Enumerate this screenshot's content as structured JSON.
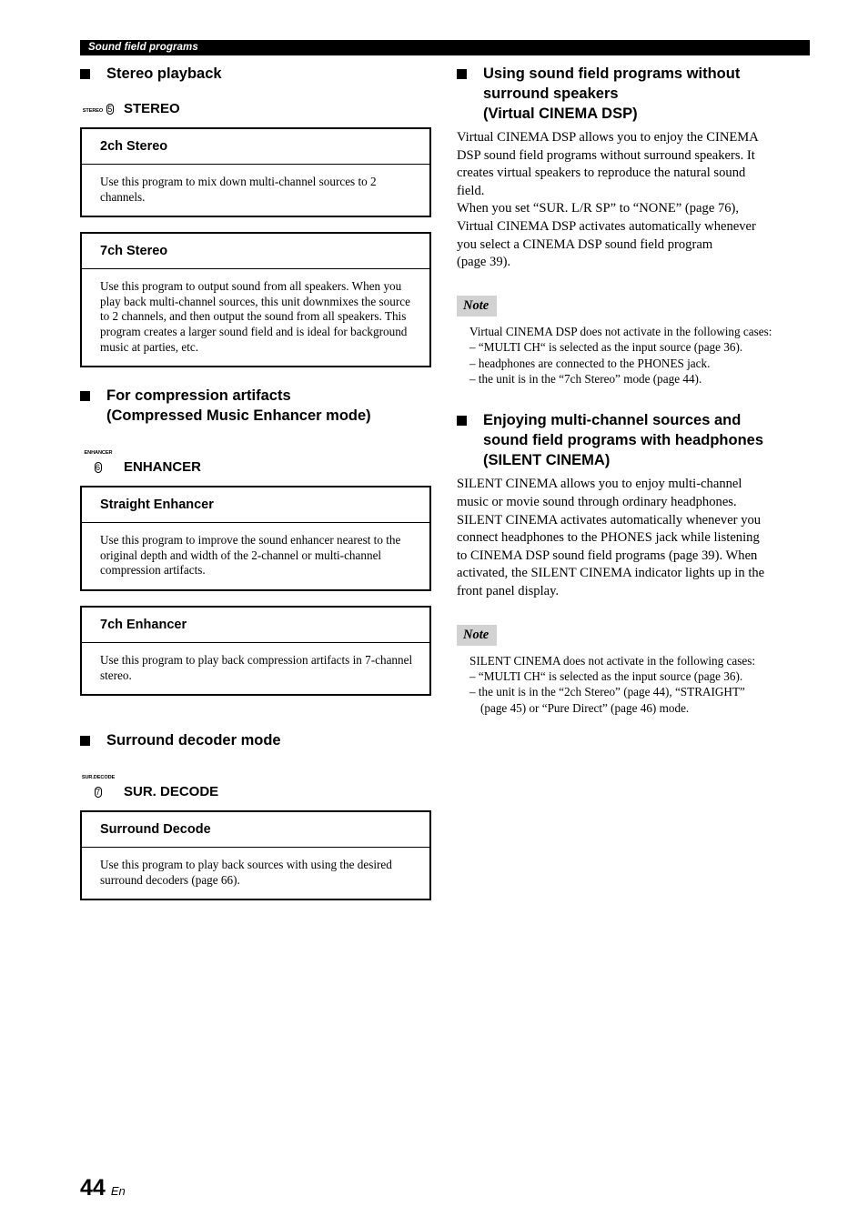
{
  "header": {
    "running_title": "Sound field programs"
  },
  "footer": {
    "page_number": "44",
    "language_code": "En"
  },
  "left_column": {
    "section_stereo": {
      "heading": "Stereo playback",
      "key": {
        "cap_label": "STEREO",
        "number": "5",
        "label": "STEREO"
      },
      "programs": [
        {
          "name": "2ch Stereo",
          "description": "Use this program to mix down multi-channel sources to 2 channels."
        },
        {
          "name": "7ch Stereo",
          "description": "Use this program to output sound from all speakers. When you play back multi-channel sources, this unit downmixes the source to 2 channels, and then output the sound from all speakers. This program creates a larger sound field and is ideal for background music at parties, etc."
        }
      ]
    },
    "section_enhancer": {
      "heading_line1": "For compression artifacts",
      "heading_line2": "(Compressed Music Enhancer mode)",
      "key": {
        "cap_label": "ENHANCER",
        "number": "6",
        "label": "ENHANCER"
      },
      "programs": [
        {
          "name": "Straight Enhancer",
          "description": "Use this program to improve the sound enhancer nearest to the original depth and width of the 2-channel or multi-channel compression artifacts."
        },
        {
          "name": "7ch Enhancer",
          "description": "Use this program to play back compression artifacts in 7-channel stereo."
        }
      ]
    },
    "section_surround_decoder": {
      "heading": "Surround decoder mode",
      "key": {
        "cap_label": "SUR.DECODE",
        "number": "7",
        "label": "SUR. DECODE"
      },
      "programs": [
        {
          "name": "Surround Decode",
          "description": "Use this program to play back sources with using the desired surround decoders (page 66)."
        }
      ]
    }
  },
  "right_column": {
    "section_virtual_cinema": {
      "heading_line1": "Using sound field programs without",
      "heading_line2": "surround speakers",
      "heading_line3": "(Virtual CINEMA DSP)",
      "body_lines": [
        "Virtual CINEMA DSP allows you to enjoy the CINEMA",
        "DSP sound field programs without surround speakers. It",
        "creates virtual speakers to reproduce the natural sound",
        "field.",
        "When you set “SUR. L/R SP” to “NONE” (page 76),",
        "Virtual CINEMA DSP activates automatically whenever",
        "you select a CINEMA DSP sound field program",
        "(page 39)."
      ],
      "note": {
        "label": "Note",
        "lines": [
          "Virtual CINEMA DSP does not activate in the following cases:",
          "– “MULTI CH“ is selected as the input source (page 36).",
          "– headphones are connected to the PHONES jack.",
          "– the unit is in the “7ch Stereo” mode (page 44)."
        ]
      }
    },
    "section_silent_cinema": {
      "heading_line1": "Enjoying multi-channel sources and",
      "heading_line2": "sound field programs with headphones",
      "heading_line3": "(SILENT CINEMA)",
      "body_lines": [
        "SILENT CINEMA allows you to enjoy multi-channel",
        "music or movie sound through ordinary headphones.",
        "SILENT CINEMA activates automatically whenever you",
        "connect headphones to the PHONES jack while listening",
        "to CINEMA DSP sound field programs (page 39). When",
        "activated, the SILENT CINEMA indicator lights up in the",
        "front panel display."
      ],
      "note": {
        "label": "Note",
        "lines": [
          "SILENT CINEMA does not activate in the following cases:",
          "–  “MULTI CH“ is selected as the input source (page 36).",
          "–  the unit is in the “2ch Stereo” (page 44), “STRAIGHT”",
          "(page 45) or “Pure Direct” (page 46) mode."
        ]
      }
    }
  }
}
